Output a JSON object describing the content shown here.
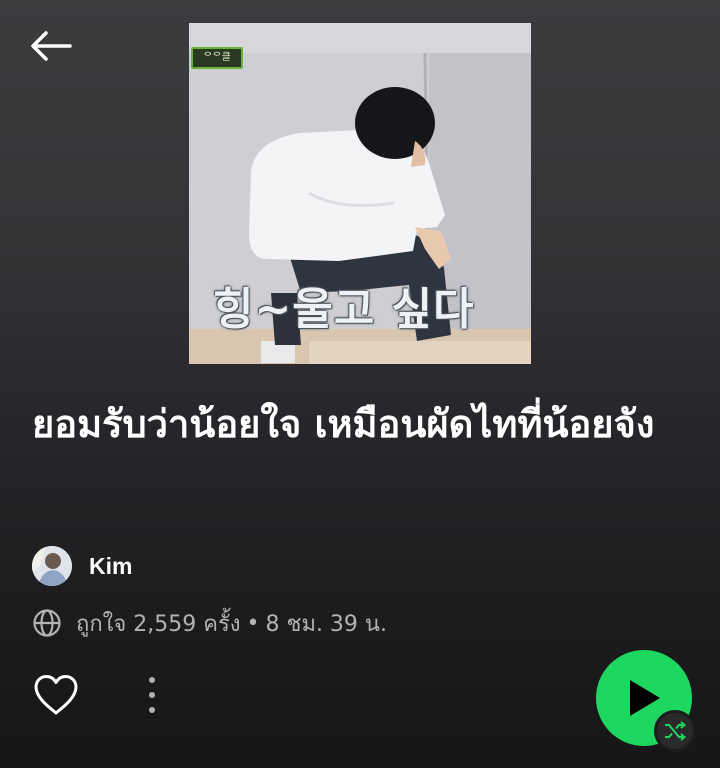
{
  "playlist": {
    "title": "ยอมรับว่าน้อยใจ เหมือนผัดไทที่น้อยจัง",
    "owner": "Kim",
    "likes": "ถูกใจ 2,559 ครั้ง",
    "separator": "•",
    "duration": "8 ชม. 39 น."
  },
  "cover": {
    "caption": "힝~울고 싶다",
    "channel_tag": "ᄋᄋ클ᄋᄋᄋ"
  },
  "icons": {
    "back": "arrow-left-icon",
    "globe": "globe-icon",
    "like": "heart-icon",
    "more": "more-vertical-icon",
    "play": "play-icon",
    "shuffle": "shuffle-icon"
  },
  "colors": {
    "accent": "#1ed760",
    "text_primary": "#ffffff",
    "text_secondary": "#b3b3b3",
    "background_top": "#3c3b3e",
    "background_bottom": "#161617"
  }
}
